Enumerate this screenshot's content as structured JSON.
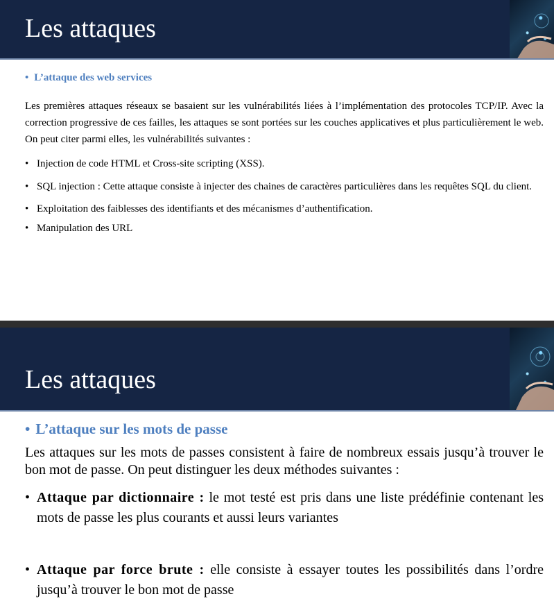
{
  "slide1": {
    "title": "Les attaques",
    "section": "L’attaque des web services",
    "paragraph": "Les premières attaques réseaux se basaient sur les vulnérabilités liées à l’implémentation des protocoles TCP/IP. Avec la correction progressive de ces failles,  les attaques se sont portées sur les couches applicatives et plus particulièrement le web. On peut citer parmi elles, les vulnérabilités suivantes :",
    "items": [
      "Injection de code HTML et Cross-site scripting (XSS).",
      "SQL injection : Cette attaque consiste à injecter des chaines de caractères particulières dans les requêtes SQL du client.",
      "Exploitation des faiblesses des identifiants et des mécanismes d’authentification.",
      "Manipulation des URL"
    ]
  },
  "slide2": {
    "title": "Les attaques",
    "section": "L’attaque sur les mots de passe",
    "paragraph": "Les attaques sur les mots de passes consistent à faire de nombreux essais jusqu’à trouver le bon mot de passe. On peut distinguer les deux méthodes suivantes :",
    "items": [
      {
        "term": "Attaque par dictionnaire :",
        "text": " le mot testé est pris dans une liste prédéfinie contenant les mots de passe les plus courants et aussi leurs variantes"
      },
      {
        "term": "Attaque par force brute :",
        "text": " elle consiste à essayer toutes les possibilités dans l’ordre jusqu’à trouver le bon mot de passe"
      }
    ]
  },
  "bullet_glyph": "•",
  "colors": {
    "banner": "#152544",
    "heading": "#4e7fbf",
    "divider": "#2e2e2e"
  },
  "icons": [
    "hand-tech-photo-icon"
  ]
}
